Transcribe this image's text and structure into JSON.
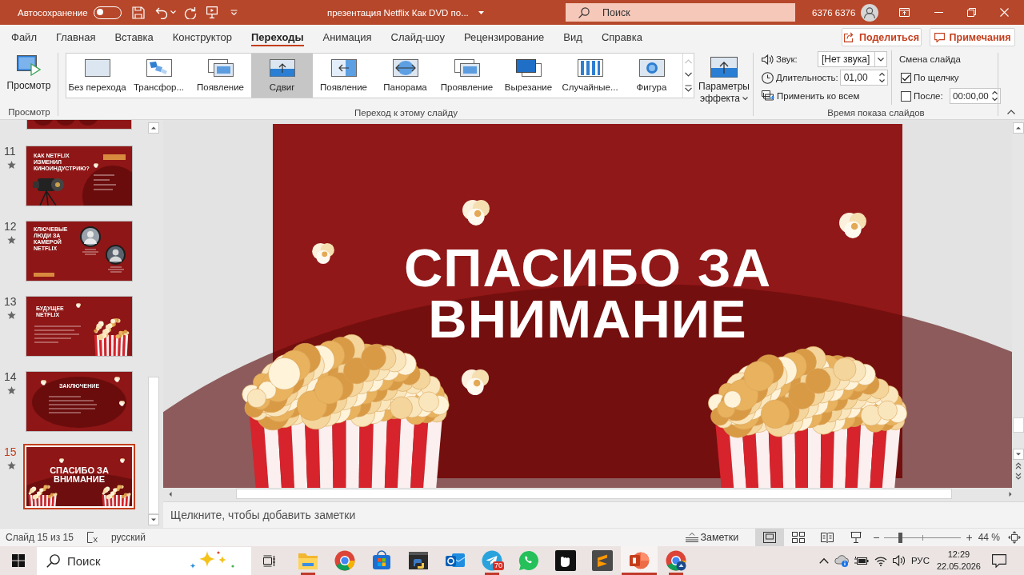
{
  "title_bar": {
    "autosave_label": "Автосохранение",
    "autosave_on": false,
    "document_title": "презентация Netflix Как DVD по...",
    "search_placeholder": "Поиск",
    "user_name": "6376 6376"
  },
  "ribbon_tabs": [
    {
      "label": "Файл",
      "selected": false
    },
    {
      "label": "Главная",
      "selected": false
    },
    {
      "label": "Вставка",
      "selected": false
    },
    {
      "label": "Конструктор",
      "selected": false
    },
    {
      "label": "Переходы",
      "selected": true
    },
    {
      "label": "Анимация",
      "selected": false
    },
    {
      "label": "Слайд-шоу",
      "selected": false
    },
    {
      "label": "Рецензирование",
      "selected": false
    },
    {
      "label": "Вид",
      "selected": false
    },
    {
      "label": "Справка",
      "selected": false
    }
  ],
  "ribbon_actions": [
    {
      "label": "Поделиться",
      "kind": "share"
    },
    {
      "label": "Примечания",
      "kind": "comments"
    }
  ],
  "preview_group": {
    "button": "Просмотр",
    "label": "Просмотр"
  },
  "transition_group": {
    "label": "Переход к этому слайду",
    "scroll_up_enabled": false,
    "effect_options": "Параметры эффекта",
    "gallery": [
      {
        "label": "Без перехода",
        "kind": "blank",
        "selected": false
      },
      {
        "label": "Трансфор...",
        "kind": "morph",
        "selected": false
      },
      {
        "label": "Появление",
        "kind": "overlap",
        "selected": false
      },
      {
        "label": "Сдвиг",
        "kind": "push",
        "selected": true
      },
      {
        "label": "Появление",
        "kind": "arrow-left",
        "selected": false
      },
      {
        "label": "Панорама",
        "kind": "split",
        "selected": false
      },
      {
        "label": "Проявление",
        "kind": "overlap",
        "selected": false
      },
      {
        "label": "Вырезание",
        "kind": "overlap-dark",
        "selected": false
      },
      {
        "label": "Случайные...",
        "kind": "bars",
        "selected": false
      },
      {
        "label": "Фигура",
        "kind": "circle",
        "selected": false
      }
    ]
  },
  "timing_group": {
    "label": "Время показа слайдов",
    "sound_label": "Звук:",
    "sound_value": "[Нет звука]",
    "duration_label": "Длительность:",
    "duration_value": "01,00",
    "apply_all": "Применить ко всем",
    "advance_title": "Смена слайда",
    "advance": [
      {
        "label": "По щелчку",
        "checked": true
      },
      {
        "label": "После:",
        "checked": false,
        "value": "00:00,00"
      }
    ]
  },
  "thumbnails": [
    {
      "number": "11",
      "title": "КАК NETFLIX ИЗМЕНИЛ КИНОИНДУСТРИЮ?",
      "kind": "camera",
      "transition": true,
      "selected": false
    },
    {
      "number": "12",
      "title": "КЛЮЧЕВЫЕ ЛЮДИ ЗА КАМЕРОЙ NETFLIX",
      "kind": "people",
      "transition": true,
      "selected": false
    },
    {
      "number": "13",
      "title": "БУДУЩЕЕ NETFLIX",
      "kind": "popcorn",
      "transition": true,
      "selected": false
    },
    {
      "number": "14",
      "title": "ЗАКЛЮЧЕНИЕ",
      "kind": "oval",
      "transition": true,
      "selected": false
    },
    {
      "number": "15",
      "title": "СПАСИБО ЗА ВНИМАНИЕ",
      "kind": "closing",
      "transition": true,
      "selected": true
    }
  ],
  "slide": {
    "title": "СПАСИБО ЗА ВНИМАНИЕ"
  },
  "notes": {
    "placeholder": "Щелкните, чтобы добавить заметки"
  },
  "status_bar": {
    "slide_info": "Слайд 15 из 15",
    "language": "русский",
    "notes_button": "Заметки",
    "views": [
      {
        "kind": "normal",
        "selected": true
      },
      {
        "kind": "sorter",
        "selected": false
      },
      {
        "kind": "reading",
        "selected": false
      },
      {
        "kind": "slideshow",
        "selected": false
      }
    ],
    "zoom": {
      "minus": "−",
      "plus": "+",
      "level": 0.2,
      "reading": "44 %"
    }
  },
  "taskbar": {
    "search_placeholder": "Поиск",
    "apps": [
      {
        "kind": "folder",
        "running": true,
        "active": false
      },
      {
        "kind": "browser",
        "running": false,
        "active": false
      },
      {
        "kind": "store",
        "running": false,
        "active": false
      },
      {
        "kind": "code",
        "running": false,
        "active": false
      },
      {
        "kind": "mail",
        "running": false,
        "active": false
      },
      {
        "kind": "plane",
        "running": true,
        "active": false,
        "badge": "70"
      },
      {
        "kind": "chat",
        "running": false,
        "active": false
      },
      {
        "kind": "fist",
        "running": false,
        "active": false
      },
      {
        "kind": "editor",
        "running": false,
        "active": false
      },
      {
        "kind": "slides",
        "running": true,
        "active": true
      },
      {
        "kind": "browser-badge",
        "running": true,
        "active": false
      }
    ],
    "language": "РУС",
    "time": "12:29",
    "date": "22.05.2026"
  }
}
